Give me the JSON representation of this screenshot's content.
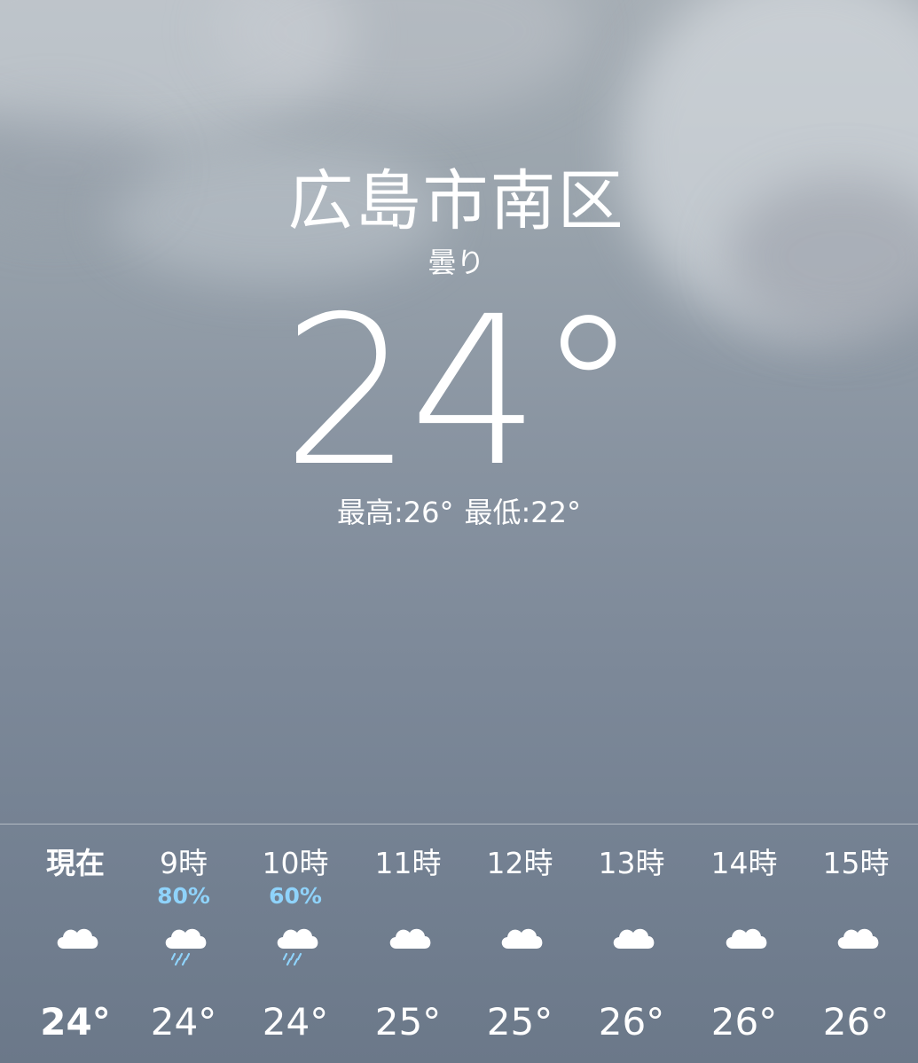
{
  "location": {
    "city": "広島市南区",
    "condition": "曇り",
    "temperature": "24°",
    "high": "最高:26°",
    "low": "最低:22°"
  },
  "hourly": [
    {
      "time": "現在",
      "precip": "",
      "icon": "cloud-icon",
      "temp": "24°",
      "current": true
    },
    {
      "time": "9時",
      "precip": "80%",
      "icon": "cloud-rain-icon",
      "temp": "24°"
    },
    {
      "time": "10時",
      "precip": "60%",
      "icon": "cloud-rain-icon",
      "temp": "24°"
    },
    {
      "time": "11時",
      "precip": "",
      "icon": "cloud-icon",
      "temp": "25°"
    },
    {
      "time": "12時",
      "precip": "",
      "icon": "cloud-icon",
      "temp": "25°"
    },
    {
      "time": "13時",
      "precip": "",
      "icon": "cloud-icon",
      "temp": "26°"
    },
    {
      "time": "14時",
      "precip": "",
      "icon": "cloud-icon",
      "temp": "26°"
    },
    {
      "time": "15時",
      "precip": "",
      "icon": "cloud-icon",
      "temp": "26°"
    }
  ],
  "colors": {
    "precip_text": "#8fd3fb",
    "text": "#ffffff"
  }
}
